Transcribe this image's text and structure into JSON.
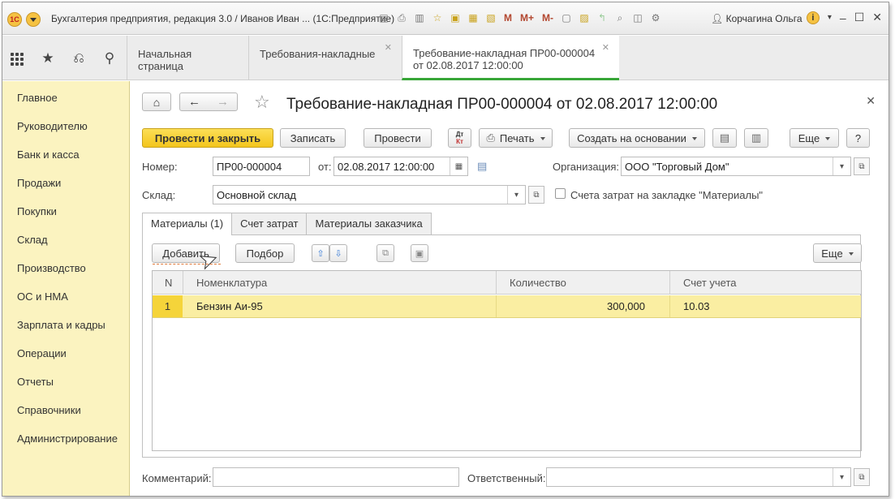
{
  "window": {
    "title": "Бухгалтерия предприятия, редакция 3.0 / Иванов Иван ... (1С:Предприятие)",
    "user": "Корчагина Ольга",
    "logo_text": "1С"
  },
  "toolbar_m": [
    "M",
    "M+",
    "M-"
  ],
  "tabs": [
    {
      "label": "Начальная страница"
    },
    {
      "label": "Требования-накладные"
    },
    {
      "label_line1": "Требование-накладная ПР00-000004",
      "label_line2": "от 02.08.2017 12:00:00"
    }
  ],
  "sidebar": {
    "items": [
      {
        "label": "Главное"
      },
      {
        "label": "Руководителю"
      },
      {
        "label": "Банк и касса"
      },
      {
        "label": "Продажи"
      },
      {
        "label": "Покупки"
      },
      {
        "label": "Склад"
      },
      {
        "label": "Производство"
      },
      {
        "label": "ОС и НМА"
      },
      {
        "label": "Зарплата и кадры"
      },
      {
        "label": "Операции"
      },
      {
        "label": "Отчеты"
      },
      {
        "label": "Справочники"
      },
      {
        "label": "Администрирование"
      }
    ]
  },
  "document": {
    "title": "Требование-накладная ПР00-000004 от 02.08.2017 12:00:00",
    "buttons": {
      "post_close": "Провести и закрыть",
      "save": "Записать",
      "post": "Провести",
      "dtkt_top": "Дт",
      "dtkt_bottom": "Кт",
      "print": "Печать",
      "create_based": "Создать на основании",
      "more": "Еще",
      "help": "?"
    },
    "fields": {
      "number_label": "Номер:",
      "number_value": "ПР00-000004",
      "from_label": "от:",
      "date_value": "02.08.2017 12:00:00",
      "org_label": "Организация:",
      "org_value": "ООО \"Торговый Дом\"",
      "warehouse_label": "Склад:",
      "warehouse_value": "Основной склад",
      "checkbox_label": "Счета затрат на закладке \"Материалы\"",
      "checkbox_checked": false,
      "comment_label": "Комментарий:",
      "comment_value": "",
      "responsible_label": "Ответственный:",
      "responsible_value": ""
    },
    "inner_tabs": [
      {
        "label": "Материалы (1)"
      },
      {
        "label": "Счет затрат"
      },
      {
        "label": "Материалы заказчика"
      }
    ],
    "table_toolbar": {
      "add": "Добавить",
      "pick": "Подбор",
      "more": "Еще"
    },
    "table": {
      "columns": [
        "N",
        "Номенклатура",
        "Количество",
        "Счет учета"
      ],
      "rows": [
        {
          "n": "1",
          "item": "Бензин Аи-95",
          "qty": "300,000",
          "account": "10.03"
        }
      ]
    }
  }
}
